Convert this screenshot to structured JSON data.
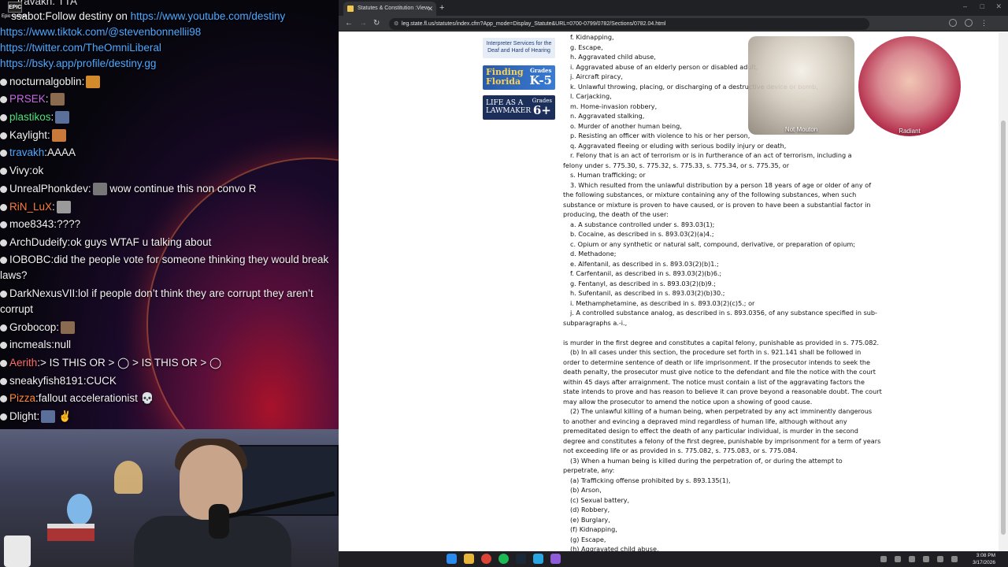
{
  "chat": {
    "logo_text": "EPIC",
    "logo_sub": "Epic Games",
    "top_partial": "travakh: TTA",
    "bot_user": "ssabot",
    "bot_text": "Follow destiny on ",
    "links": [
      "https://www.youtube.com/destiny",
      "https://www.tiktok.com/@stevenbonnellii98",
      "https://twitter.com/TheOmniLiberal",
      "https://bsky.app/profile/destiny.gg"
    ],
    "messages": [
      {
        "user": "nocturnalgoblin",
        "text": "",
        "color": "#f2f2f2",
        "emote": "#d38a2b"
      },
      {
        "user": "PRSEK",
        "text": "",
        "color": "#c86ce6",
        "emote": "#8a6b4f"
      },
      {
        "user": "plastikos",
        "text": "",
        "color": "#4ee27a",
        "emote": "#5a6f9a"
      },
      {
        "user": "Kaylight",
        "text": "",
        "color": "#f2f2f2",
        "emote": "#c97a3b"
      },
      {
        "user": "travakh",
        "text": "AAAA",
        "color": "#4ea8ff",
        "emote": ""
      },
      {
        "user": "Vivy",
        "text": "ok",
        "color": "#f2f2f2",
        "emote": ""
      },
      {
        "user": "UnrealPhonkdev",
        "text": " wow continue this non convo R",
        "color": "#f2f2f2",
        "emote": "#777"
      },
      {
        "user": "RiN_LuX",
        "text": "",
        "color": "#ff7b3b",
        "emote": "#9a9a9a"
      },
      {
        "user": "moe8343",
        "text": "????",
        "color": "#f2f2f2",
        "emote": ""
      },
      {
        "user": "ArchDudeify",
        "text": "ok guys WTAF u talking about",
        "color": "#f2f2f2",
        "emote": ""
      },
      {
        "user": "IOBOBC",
        "text": "did the people vote for someone thinking they would break laws?",
        "color": "#f2f2f2",
        "emote": ""
      },
      {
        "user": "DarkNexusVII",
        "text": "lol if people don’t think they are corrupt they aren’t corrupt",
        "color": "#f2f2f2",
        "emote": ""
      },
      {
        "user": "Grobocop",
        "text": "",
        "color": "#f2f2f2",
        "emote": "#8a6b4f"
      },
      {
        "user": "incmeals",
        "text": "null",
        "color": "#f2f2f2",
        "emote": ""
      },
      {
        "user": "Aerith",
        "text": "> IS THIS  OR  > ◯ > IS THIS  OR  > ◯",
        "color": "#ff6b6b",
        "emote": ""
      },
      {
        "user": "sneakyfish8191",
        "text": "CUCK",
        "color": "#f2f2f2",
        "emote": ""
      },
      {
        "user": "Pizza",
        "text": "fallout accelerationist 💀",
        "color": "#ff8a3b",
        "emote": ""
      },
      {
        "user": "Dlight",
        "text": " ✌",
        "color": "#f2f2f2",
        "emote": "#5a6f9a"
      }
    ]
  },
  "browser": {
    "tab_title": "Statutes & Constitution :View",
    "new_tab": "+",
    "url": "leg.state.fl.us/statutes/index.cfm?App_mode=Display_Statute&URL=0700-0799/0782/Sections/0782.04.html",
    "minimize": "–",
    "maximize": "□",
    "close": "✕",
    "back": "←",
    "forward": "→",
    "reload": "↻"
  },
  "sidebar_promos": {
    "interp": "Interpreter Services for the Deaf and Hard of Hearing",
    "ff_title_1": "Finding",
    "ff_title_2": "Florida",
    "ff_grades": "Grades",
    "ff_level": "K-5",
    "life_title_1": "LIFE AS A",
    "life_title_2": "LAWMAKER",
    "life_grades": "Grades",
    "life_level": "6+"
  },
  "statute_lines": [
    "f.   Kidnapping,",
    "g.   Escape,",
    "h.   Aggravated child abuse,",
    "i.   Aggravated abuse of an elderly person or disabled adult,",
    "j.   Aircraft piracy,",
    "k.   Unlawful throwing, placing, or discharging of a destructive device or bomb,",
    "l.   Carjacking,",
    "m.   Home-invasion robbery,",
    "n.   Aggravated stalking,",
    "o.   Murder of another human being,",
    "p.   Resisting an officer with violence to his or her person,",
    "q.   Aggravated fleeing or eluding with serious bodily injury or death,",
    "r.   Felony that is an act of terrorism or is in furtherance of an act of terrorism, including a",
    "felony under s. 775.30, s. 775.32, s. 775.33, s. 775.34, or s. 775.35, or",
    "s.   Human trafficking; or",
    "3.   Which resulted from the unlawful distribution by a person 18 years of age or older of any of",
    "the following substances, or mixture containing any of the following substances, when such",
    "substance or mixture is proven to have caused, or is proven to have been a substantial factor in",
    "producing, the death of the user:",
    "a.   A substance controlled under s. 893.03(1);",
    "b.   Cocaine, as described in s. 893.03(2)(a)4.;",
    "c.   Opium or any synthetic or natural salt, compound, derivative, or preparation of opium;",
    "d.   Methadone;",
    "e.   Alfentanil, as described in s. 893.03(2)(b)1.;",
    "f.   Carfentanil, as described in s. 893.03(2)(b)6.;",
    "g.   Fentanyl, as described in s. 893.03(2)(b)9.;",
    "h.   Sufentanil, as described in s. 893.03(2)(b)30.;",
    "i.   Methamphetamine, as described in s. 893.03(2)(c)5.; or",
    "j.   A controlled substance analog, as described in s. 893.0356, of any substance specified in sub-",
    "subparagraphs a.-i.,",
    "",
    "is murder in the first degree and constitutes a capital felony, punishable as provided in s. 775.082.",
    "(b)   In all cases under this section, the procedure set forth in s. 921.141 shall be followed in",
    "order to determine sentence of death or life imprisonment. If the prosecutor intends to seek the",
    "death penalty, the prosecutor must give notice to the defendant and file the notice with the court",
    "within 45 days after arraignment. The notice must contain a list of the aggravating factors the",
    "state intends to prove and has reason to believe it can prove beyond a reasonable doubt. The court",
    "may allow the prosecutor to amend the notice upon a showing of good cause.",
    "(2)   The unlawful killing of a human being, when perpetrated by any act imminently dangerous",
    "to another and evincing a depraved mind regardless of human life, although without any",
    "premeditated design to effect the death of any particular individual, is murder in the second",
    "degree and constitutes a felony of the first degree, punishable by imprisonment for a term of years",
    "not exceeding life or as provided in s. 775.082, s. 775.083, or s. 775.084.",
    "(3)   When a human being is killed during the perpetration of, or during the attempt to",
    "perpetrate, any:",
    "(a)   Trafficking offense prohibited by s. 893.135(1),",
    "(b)   Arson,",
    "(c)   Sexual battery,",
    "(d)   Robbery,",
    "(e)   Burglary,",
    "(f)   Kidnapping,",
    "(g)   Escape,",
    "(h)   Aggravated child abuse,"
  ],
  "overlays": {
    "mouton_label": "Not Mouton",
    "radiant_label": "Radiant"
  },
  "taskbar": {
    "time": "3:08 PM",
    "date": "3/17/2026"
  }
}
